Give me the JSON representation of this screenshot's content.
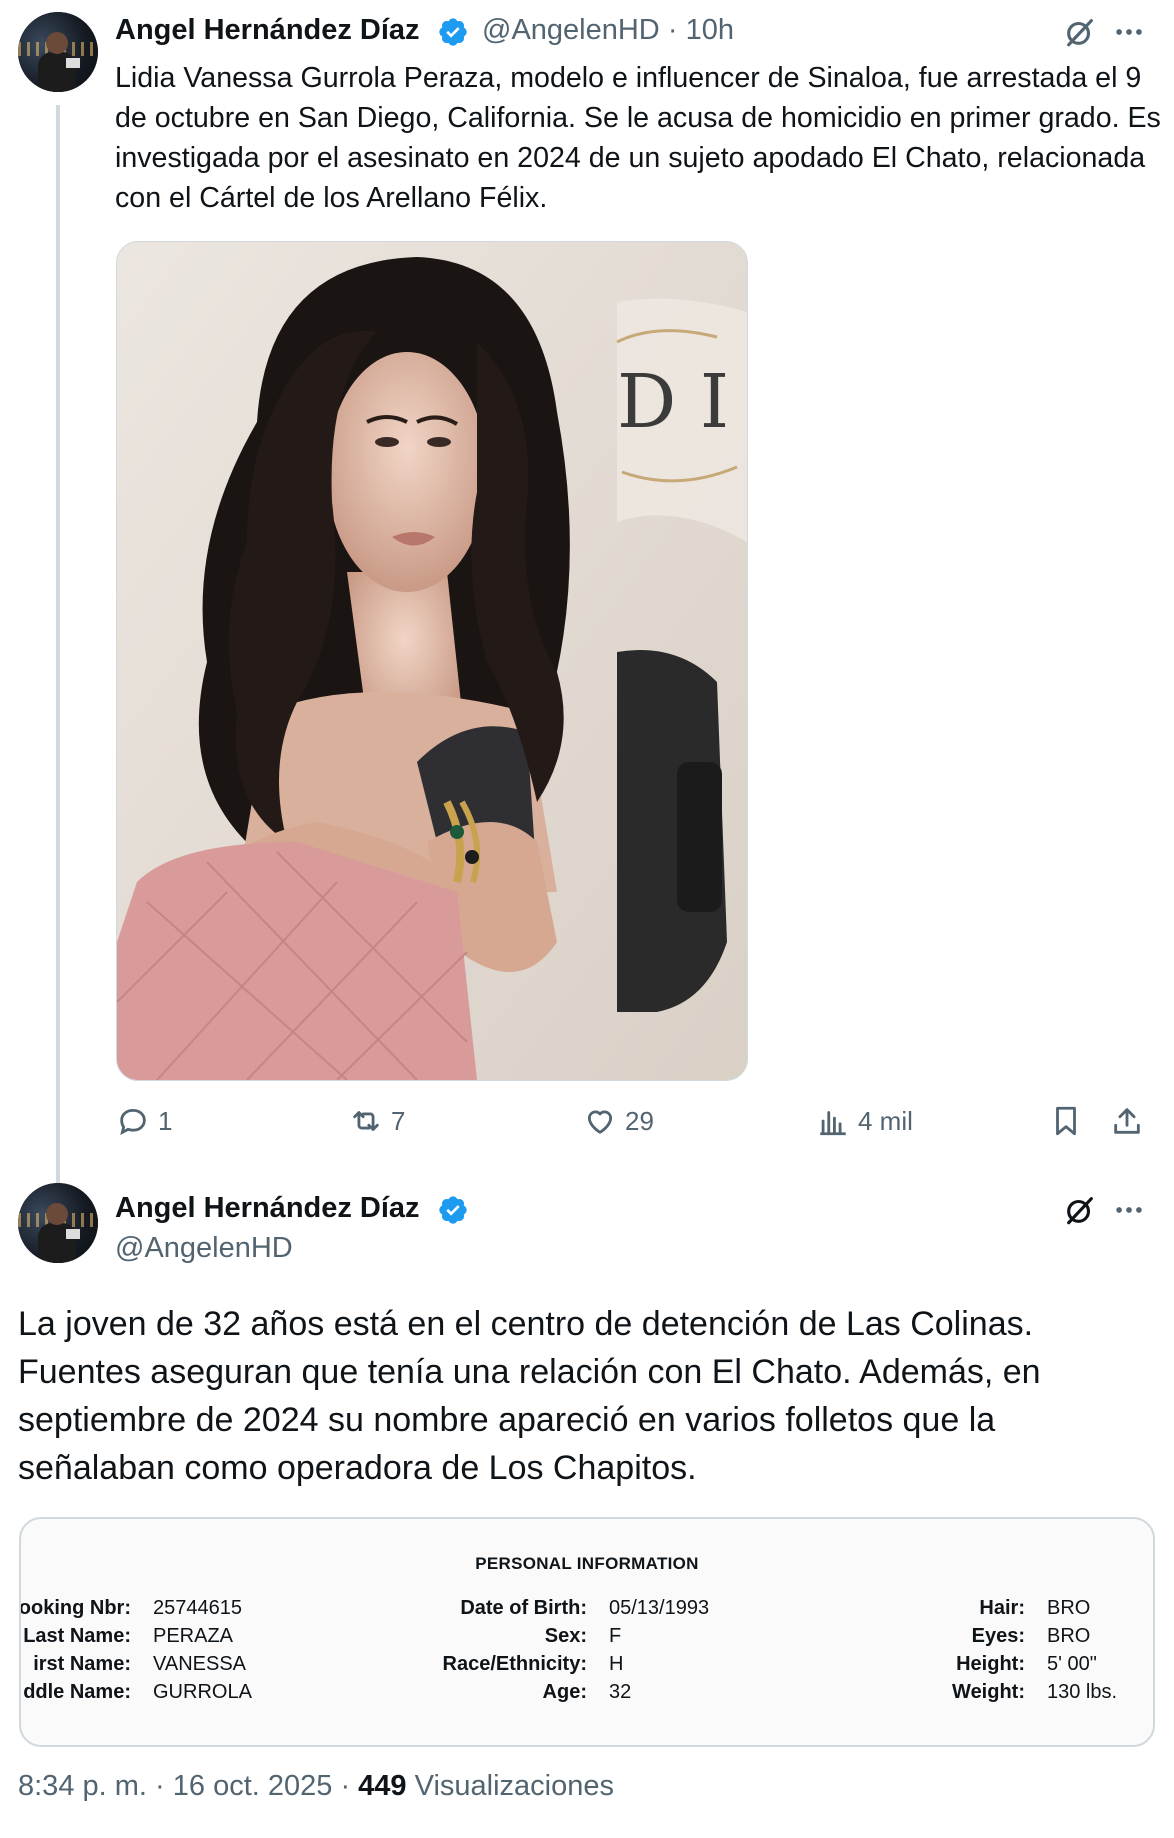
{
  "tweet1": {
    "author_name": "Angel Hernández Díaz",
    "handle": "@AngelenHD",
    "sep": "·",
    "time": "10h",
    "text": "Lidia Vanessa Gurrola Peraza, modelo e influencer de Sinaloa, fue arrestada el 9 de octubre en San Diego, California. Se le acusa de homicidio en primer grado. Es investigada por el asesinato en 2024 de un sujeto apodado El Chato, relacionada con el Cártel de los Arellano Félix.",
    "media_text": "D I",
    "actions": {
      "replies": "1",
      "reposts": "7",
      "likes": "29",
      "views": "4 mil"
    }
  },
  "tweet2": {
    "author_name": "Angel Hernández Díaz",
    "handle": "@AngelenHD",
    "text": "La joven de 32 años está en el centro de detención de Las Colinas. Fuentes aseguran que tenía una relación con El Chato. Además, en septiembre de 2024 su nombre apareció en varios folletos que la señalaban como operadora de Los Chapitos.",
    "card": {
      "title": "PERSONAL INFORMATION",
      "col1": [
        {
          "label": "ooking Nbr:",
          "value": "25744615"
        },
        {
          "label": "Last Name:",
          "value": "PERAZA"
        },
        {
          "label": "irst Name:",
          "value": "VANESSA"
        },
        {
          "label": "ddle Name:",
          "value": "GURROLA"
        }
      ],
      "col2": [
        {
          "label": "Date of Birth:",
          "value": "05/13/1993"
        },
        {
          "label": "Sex:",
          "value": "F"
        },
        {
          "label": "Race/Ethnicity:",
          "value": "H"
        },
        {
          "label": "Age:",
          "value": "32"
        }
      ],
      "col3": [
        {
          "label": "Hair:",
          "value": "BRO"
        },
        {
          "label": "Eyes:",
          "value": "BRO"
        },
        {
          "label": "Height:",
          "value": "5' 00\""
        },
        {
          "label": "Weight:",
          "value": "130 lbs."
        }
      ]
    },
    "footer": {
      "time": "8:34 p. m.",
      "date": "16 oct. 2025",
      "views_count": "449",
      "views_label": "Visualizaciones"
    }
  },
  "colors": {
    "verified": "#1d9bf0",
    "secondary_text": "#536471",
    "thread_line": "#cfd9de"
  },
  "icons": [
    "grok-icon",
    "more-icon",
    "verified-icon",
    "reply-icon",
    "repost-icon",
    "like-icon",
    "views-icon",
    "bookmark-icon",
    "share-icon"
  ]
}
